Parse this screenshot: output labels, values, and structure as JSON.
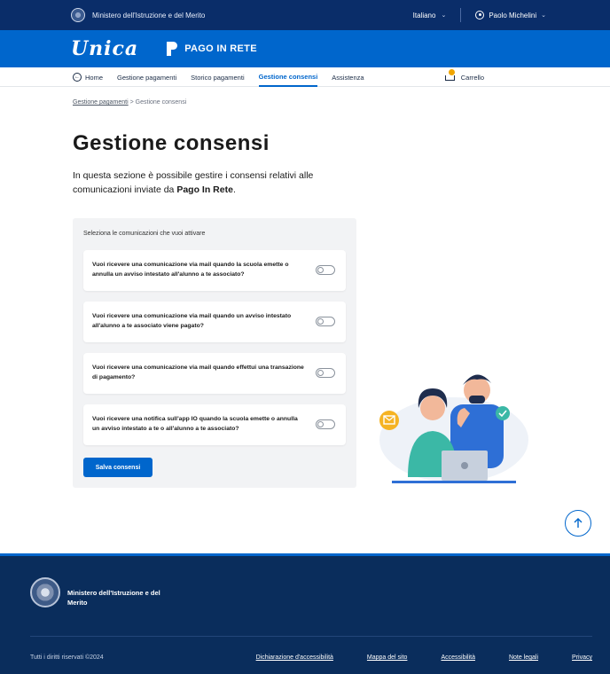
{
  "topbar": {
    "ministry": "Ministero dell'Istruzione e del Merito",
    "language": "Italiano",
    "user_name": "Paolo Michelini"
  },
  "brand": {
    "app_name": "Unica",
    "service_name": "PAGO IN RETE"
  },
  "nav": {
    "items": [
      {
        "label": "Home",
        "active": false
      },
      {
        "label": "Gestione pagamenti",
        "active": false
      },
      {
        "label": "Storico pagamenti",
        "active": false
      },
      {
        "label": "Gestione consensi",
        "active": true
      },
      {
        "label": "Assistenza",
        "active": false
      }
    ],
    "cart_label": "Carrello"
  },
  "breadcrumb": {
    "parent": "Gestione pagamenti",
    "separator": ">",
    "current": "Gestione consensi"
  },
  "page": {
    "title": "Gestione consensi",
    "intro_prefix": "In questa sezione è possibile gestire i consensi relativi alle comunicazioni inviate da ",
    "intro_bold": "Pago In Rete",
    "intro_suffix": "."
  },
  "consents": {
    "heading": "Seleziona le comunicazioni che vuoi attivare",
    "items": [
      {
        "text": "Vuoi ricevere una comunicazione via mail quando la scuola emette o annulla un avviso intestato all'alunno a te associato?",
        "enabled": false
      },
      {
        "text": "Vuoi ricevere una comunicazione via mail quando un avviso intestato all'alunno a te associato viene pagato?",
        "enabled": false
      },
      {
        "text": "Vuoi ricevere una comunicazione via mail quando effettui una transazione di pagamento?",
        "enabled": false
      },
      {
        "text": "Vuoi ricevere una notifica sull'app IO quando la scuola emette o annulla un avviso intestato a te o all'alunno a te associato?",
        "enabled": false
      }
    ],
    "save_label": "Salva consensi"
  },
  "footer": {
    "ministry_name": "Ministero dell'Istruzione e del Merito",
    "copyright": "Tutti i diritti riservati ©2024",
    "links": [
      "Dichiarazione d'accessibilità",
      "Mappa del sito",
      "Accessibilità",
      "Note legali",
      "Privacy"
    ]
  },
  "colors": {
    "primary": "#0066cc",
    "dark_blue": "#0a2d69",
    "footer_blue": "#0a2d5c",
    "panel_bg": "#f2f3f5"
  }
}
